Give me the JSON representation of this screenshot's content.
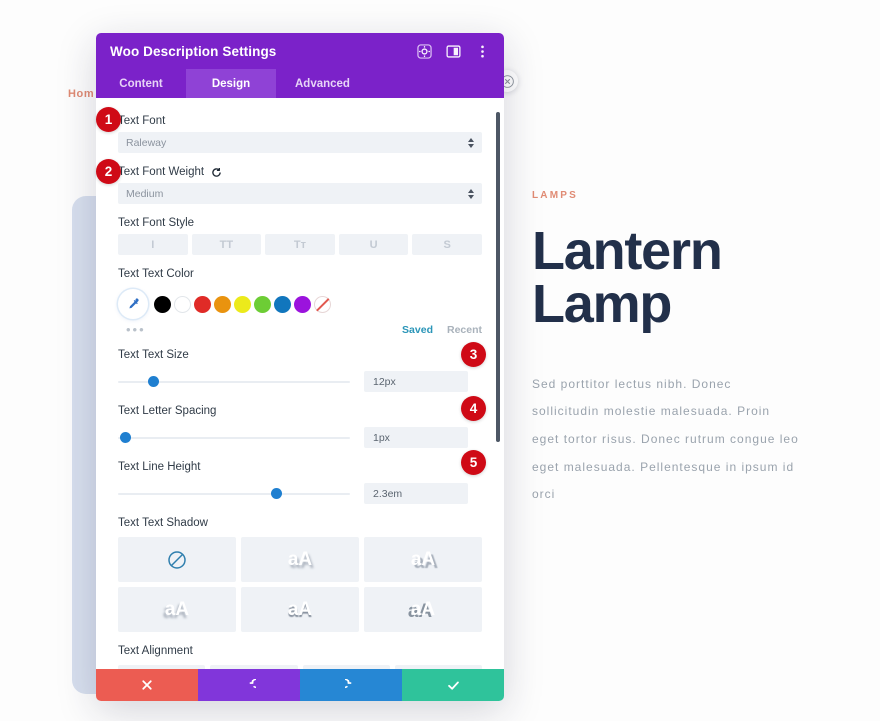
{
  "preview": {
    "breadcrumb": "Hom",
    "eyebrow": "LAMPS",
    "headline": "Lantern Lamp",
    "body": "Sed porttitor lectus nibh. Donec sollicitudin molestie malesuada. Proin eget tortor risus. Donec rutrum congue leo eget malesuada. Pellentesque in ipsum id orci",
    "accent_color": "#e08b74",
    "heading_color": "#22304a",
    "card_color": "#d7dfee"
  },
  "modal": {
    "title": "Woo Description Settings",
    "header_color": "#7b22c9",
    "header_icons": [
      "target-icon",
      "layout-icon",
      "more-vertical-icon"
    ],
    "tabs": [
      {
        "label": "Content",
        "active": false
      },
      {
        "label": "Design",
        "active": true
      },
      {
        "label": "Advanced",
        "active": false
      }
    ],
    "fields": {
      "text_font": {
        "label": "Text Font",
        "value": "Raleway"
      },
      "text_font_weight": {
        "label": "Text Font Weight",
        "value": "Medium",
        "has_reset": true
      },
      "text_font_style": {
        "label": "Text Font Style",
        "options": [
          "I",
          "TT",
          "Tт",
          "U",
          "S"
        ]
      },
      "text_text_color": {
        "label": "Text Text Color",
        "swatches": [
          "#000000",
          "#ffffff",
          "#e02b27",
          "#e9930f",
          "#ecea1b",
          "#6dcd35",
          "#1176bd",
          "#9b13dd",
          "none"
        ],
        "saved_label": "Saved",
        "recent_label": "Recent",
        "more_label": "•••"
      },
      "text_text_size": {
        "label": "Text Text Size",
        "value": "12px",
        "slider_percent": 13
      },
      "text_letter_spacing": {
        "label": "Text Letter Spacing",
        "value": "1px",
        "slider_percent": 2
      },
      "text_line_height": {
        "label": "Text Line Height",
        "value": "2.3em",
        "slider_percent": 69
      },
      "text_text_shadow": {
        "label": "Text Text Shadow",
        "options": [
          "none",
          "aA",
          "aA",
          "aA",
          "aA",
          "aA"
        ],
        "selected_index": 0
      },
      "text_alignment": {
        "label": "Text Alignment",
        "options": [
          "align-left",
          "align-center",
          "align-right",
          "align-justify"
        ],
        "selected_index": 0
      }
    },
    "footer": {
      "cancel": "cancel-button",
      "undo": "undo-button",
      "redo": "redo-button",
      "save": "save-button",
      "cancel_color": "#ec5c52",
      "undo_color": "#8136da",
      "redo_color": "#2687d4",
      "save_color": "#2fc39b"
    }
  },
  "markers": [
    {
      "number": "1"
    },
    {
      "number": "2"
    },
    {
      "number": "3"
    },
    {
      "number": "4"
    },
    {
      "number": "5"
    }
  ]
}
